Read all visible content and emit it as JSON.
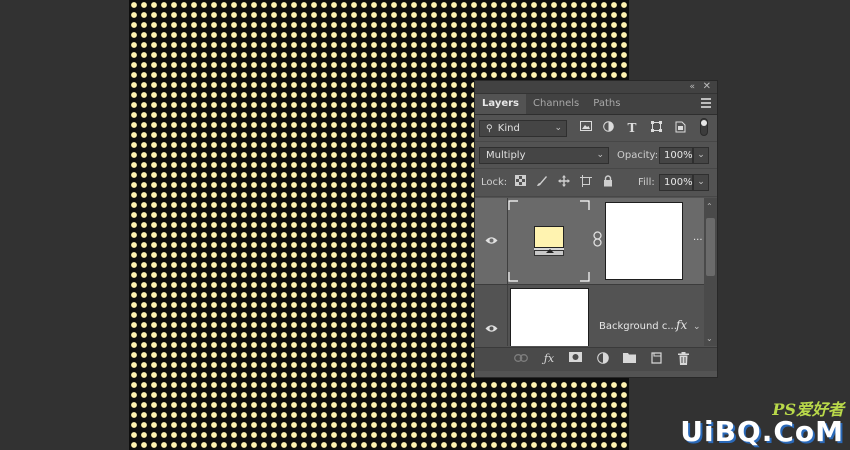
{
  "panel": {
    "tabs": [
      "Layers",
      "Channels",
      "Paths"
    ],
    "collapse_glyph": "«",
    "close_glyph": "✕",
    "kind_label": "Kind",
    "blend_mode": "Multiply",
    "opacity_label": "Opacity:",
    "opacity_value": "100%",
    "lock_label": "Lock:",
    "fill_label": "Fill:",
    "fill_value": "100%",
    "layer1_more": "...",
    "layer2_name": "Background c...",
    "layer2_fx": "fx"
  },
  "colors": {
    "dot": "#fff3b0",
    "canvas_bg": "#0d0d0d",
    "swatch": "#fff3b0"
  },
  "icons": [
    "search-icon",
    "image-filter-icon",
    "adjustment-filter-icon",
    "type-filter-icon",
    "shape-filter-icon",
    "smart-object-filter-icon",
    "filter-toggle-icon",
    "lock-transparent-icon",
    "lock-image-icon",
    "lock-position-icon",
    "lock-artboard-icon",
    "lock-all-icon",
    "eye-icon",
    "link-icon",
    "fx-icon",
    "mask-icon",
    "adjustment-icon",
    "folder-icon",
    "new-layer-icon",
    "trash-icon"
  ],
  "watermark": {
    "line1": "PS爱好者",
    "line2": "UiBQ.CoM"
  }
}
